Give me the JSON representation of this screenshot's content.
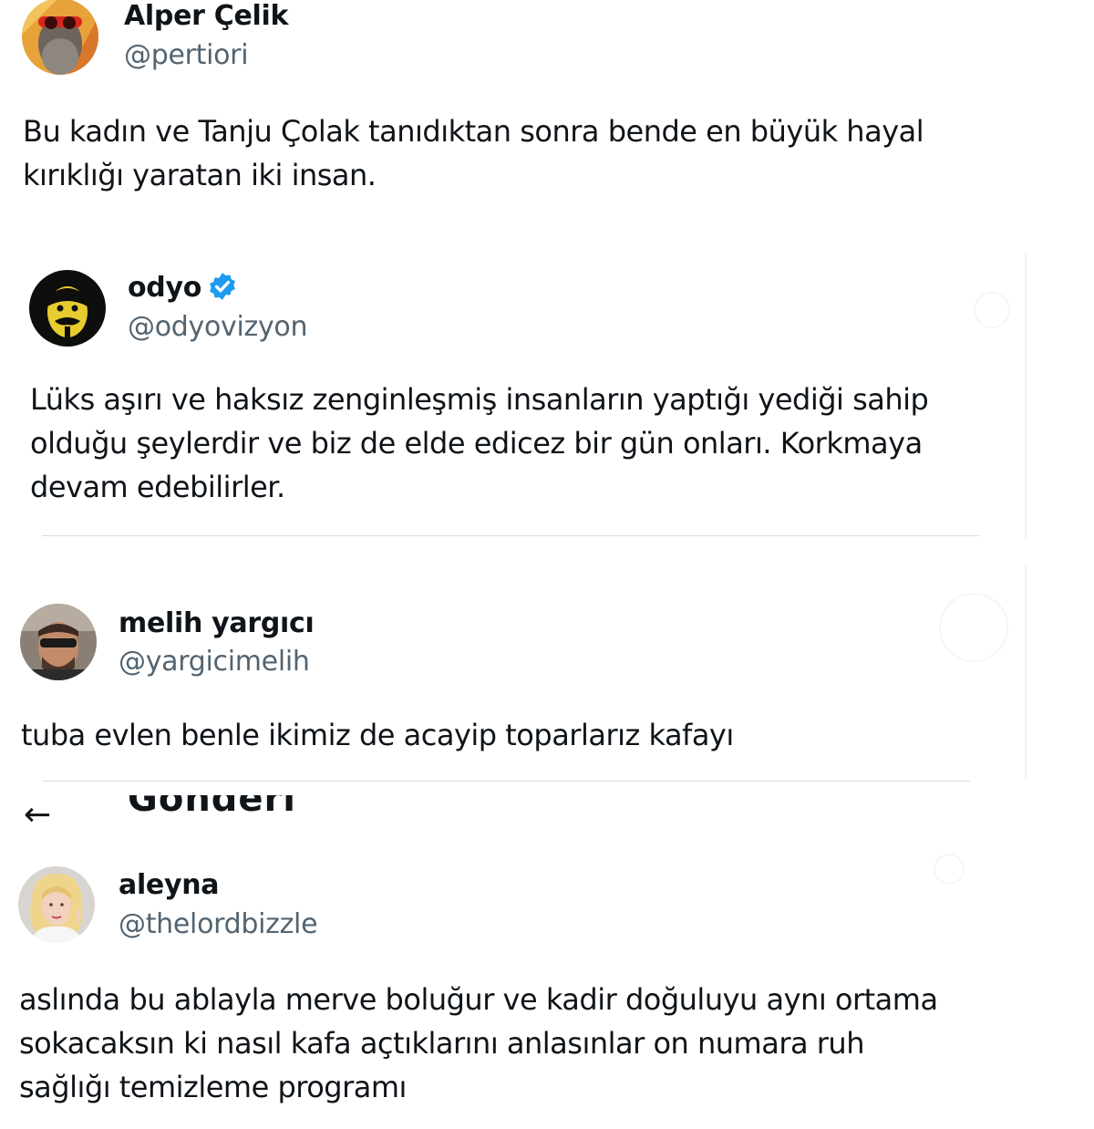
{
  "tweets": [
    {
      "name": "Alper Çelik",
      "handle": "@pertiori",
      "verified": false,
      "text_lines": [
        "Bu kadın ve Tanju Çolak tanıdıktan sonra bende en büyük hayal",
        "kırıklığı yaratan iki insan."
      ]
    },
    {
      "name": "odyo",
      "handle": "@odyovizyon",
      "verified": true,
      "text_lines": [
        "Lüks aşırı ve haksız zenginleşmiş insanların yaptığı yediği sahip",
        "olduğu şeylerdir ve biz de elde edicez bir gün onları. Korkmaya",
        "devam edebilirler."
      ]
    },
    {
      "name": "melih yargıcı",
      "handle": "@yargicimelih",
      "verified": false,
      "text_lines": [
        "tuba evlen benle ikimiz de acayip toparlarız kafayı"
      ]
    },
    {
      "name": "aleyna",
      "handle": "@thelordbizzle",
      "verified": false,
      "text_lines": [
        "aslında bu ablayla merve boluğur ve kadir doğuluyu aynı ortama",
        "sokacaksın ki nasıl kafa açtıklarını anlasınlar on numara ruh",
        "sağlığı temizleme programı"
      ]
    }
  ],
  "cut_header": {
    "back_icon": "arrow-left-icon",
    "back_glyph": "←",
    "title": "Gönderi"
  },
  "colors": {
    "text": "#0f1419",
    "handle": "#536471",
    "verified": "#1d9bf0",
    "divider": "#d8dde1"
  },
  "icons": {
    "verified": "verified-badge-icon"
  }
}
